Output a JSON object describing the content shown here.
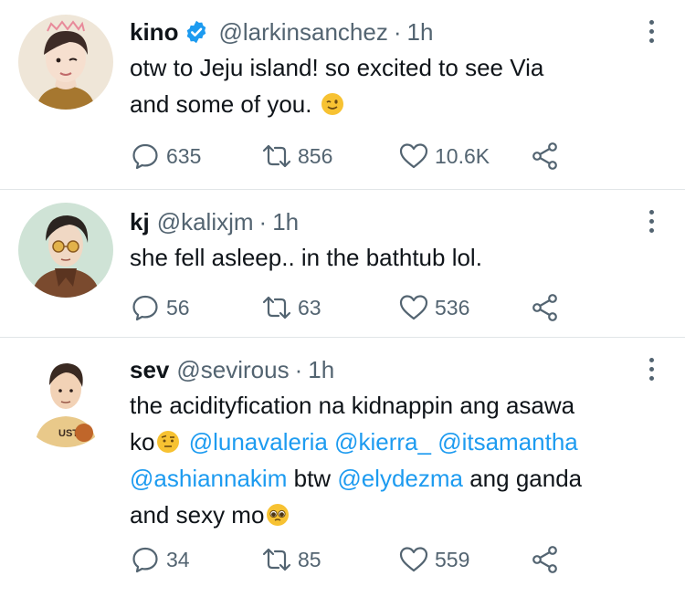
{
  "colors": {
    "text": "#0f1419",
    "secondary": "#536471",
    "mention": "#1d9bf0",
    "verified": "#1d9bf0",
    "divider": "#e1e5e8"
  },
  "tweets": [
    {
      "name": "kino",
      "verified": true,
      "handle": "@larkinsanchez",
      "separator": "·",
      "time": "1h",
      "text_lines": [
        "otw to Jeju island! so excited to see Via",
        "and some of you."
      ],
      "emoji": "winking-face",
      "replies": "635",
      "retweets": "856",
      "likes": "10.6K"
    },
    {
      "name": "kj",
      "verified": false,
      "handle": "@kalixjm",
      "separator": "·",
      "time": "1h",
      "text_lines": [
        "she fell asleep.. in the bathtub lol."
      ],
      "replies": "56",
      "retweets": "63",
      "likes": "536"
    },
    {
      "name": "sev",
      "verified": false,
      "handle": "@sevirous",
      "separator": "·",
      "time": "1h",
      "text_line1": "the acidityfication na kidnappin ang asawa",
      "text_ko": "ko",
      "emoji1": "face-with-raised-eyebrow",
      "mentions": [
        "@lunavaleria",
        "@kierra_",
        "@itsamantha",
        "@ashiannakim",
        "@elydezma"
      ],
      "text_btw": "btw",
      "text_after": "ang ganda",
      "text_last": "and sexy mo",
      "emoji2": "pleading-face",
      "replies": "34",
      "retweets": "85",
      "likes": "559"
    }
  ]
}
